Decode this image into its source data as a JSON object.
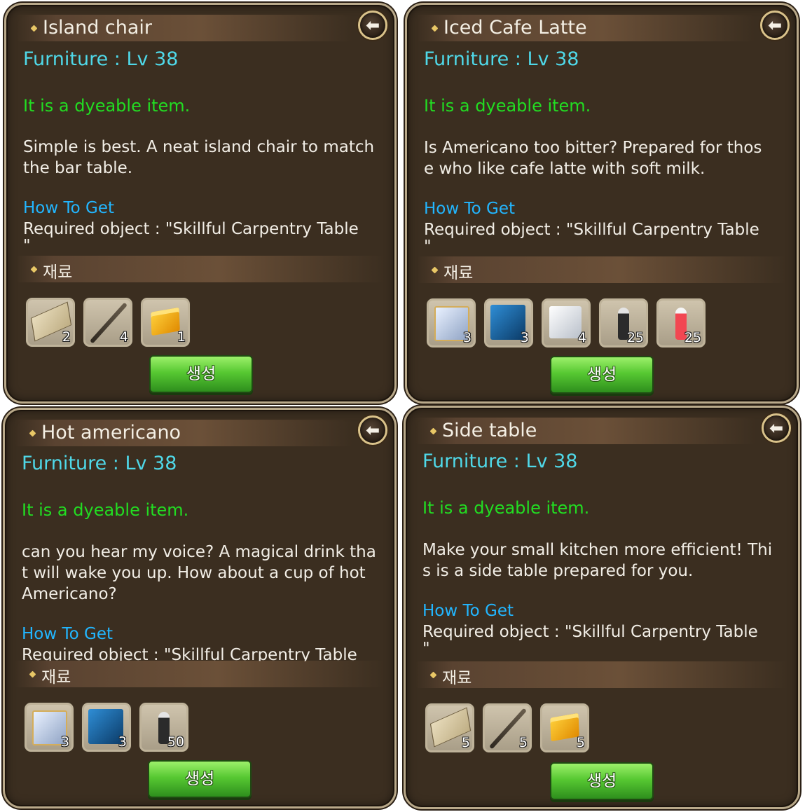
{
  "panels": [
    {
      "title": "Island chair",
      "subtitle": "Furniture : Lv 38",
      "dyeable": "It is a dyeable item.",
      "description": "Simple is best. A neat island chair to match\n the bar table.",
      "howto_heading": "How To Get",
      "howto_text": "Required object : \"Skillful Carpentry Table\n\"",
      "materials_label": "재료",
      "materials": [
        {
          "icon": "wood-plank-icon",
          "qty": "2"
        },
        {
          "icon": "wooden-stick-icon",
          "qty": "4"
        },
        {
          "icon": "gold-cube-icon",
          "qty": "1"
        }
      ],
      "create_label": "생성"
    },
    {
      "title": "Iced Cafe Latte",
      "subtitle": "Furniture : Lv 38",
      "dyeable": "It is a dyeable item.",
      "description": "Is Americano too bitter? Prepared for thos\ne who like cafe latte with soft milk.",
      "howto_heading": "How To Get",
      "howto_text": "Required object : \"Skillful Carpentry Table\n\"",
      "materials_label": "재료",
      "materials": [
        {
          "icon": "glass-cube-icon",
          "qty": "3"
        },
        {
          "icon": "blue-cube-icon",
          "qty": "3"
        },
        {
          "icon": "white-cube-icon",
          "qty": "4"
        },
        {
          "icon": "black-bottle-icon",
          "qty": "25"
        },
        {
          "icon": "red-bottle-icon",
          "qty": "25"
        }
      ],
      "create_label": "생성"
    },
    {
      "title": "Hot americano",
      "subtitle": "Furniture : Lv 38",
      "dyeable": "It is a dyeable item.",
      "description": "can you hear my voice? A magical drink tha\nt will wake you up. How about a cup of hot\nAmericano?",
      "howto_heading": "How To Get",
      "howto_text": "Required object : \"Skillful Carpentry Table",
      "materials_label": "재료",
      "materials": [
        {
          "icon": "glass-cube-icon",
          "qty": "3"
        },
        {
          "icon": "blue-cube-icon",
          "qty": "3"
        },
        {
          "icon": "black-bottle-icon",
          "qty": "50"
        }
      ],
      "create_label": "생성"
    },
    {
      "title": "Side table",
      "subtitle": "Furniture : Lv 38",
      "dyeable": "It is a dyeable item.",
      "description": "Make your small kitchen more efficient! Thi\ns is a side table prepared for you.",
      "howto_heading": "How To Get",
      "howto_text": "Required object : \"Skillful Carpentry Table\n\"",
      "materials_label": "재료",
      "materials": [
        {
          "icon": "wood-plank-icon",
          "qty": "5"
        },
        {
          "icon": "wooden-stick-icon",
          "qty": "5"
        },
        {
          "icon": "gold-cube-icon",
          "qty": "5"
        }
      ],
      "create_label": "생성"
    }
  ],
  "back_icon": "back-arrow-icon",
  "colors": {
    "panel_bg": "#3b2e20",
    "subtitle": "#4fd8e8",
    "dyeable": "#22dd22",
    "howto": "#22b6ff",
    "button_green": "#57c832"
  }
}
